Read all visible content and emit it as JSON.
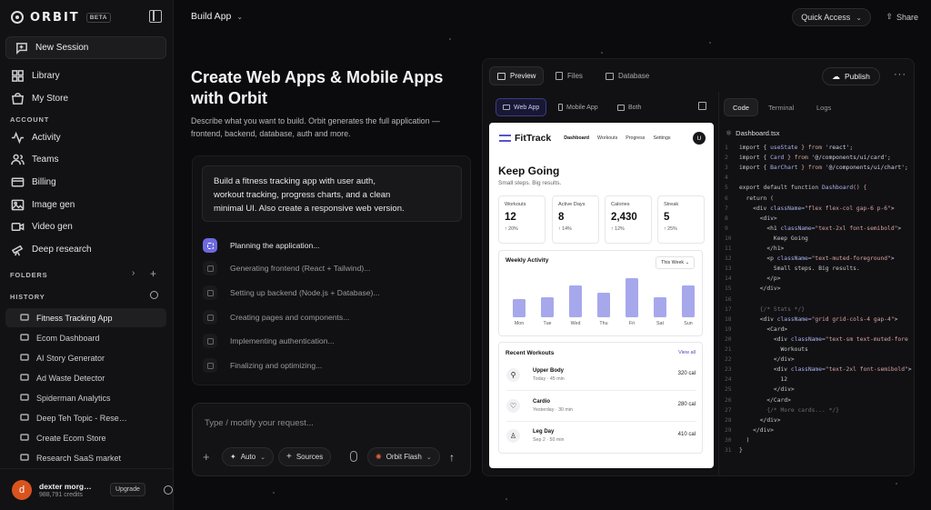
{
  "sidebar": {
    "logo": "ORBIT",
    "badge": "BETA",
    "new_session": "New Session",
    "nav": [
      {
        "label": "Library",
        "icon": "grid-icon"
      },
      {
        "label": "My Store",
        "icon": "store-icon"
      }
    ],
    "account_label": "ACCOUNT",
    "account_items": [
      {
        "label": "Activity",
        "icon": "activity-icon"
      },
      {
        "label": "Teams",
        "icon": "users-icon"
      },
      {
        "label": "Billing",
        "icon": "credit-card-icon"
      },
      {
        "label": "Image gen",
        "icon": "image-icon"
      },
      {
        "label": "Video gen",
        "icon": "video-icon"
      },
      {
        "label": "Deep research",
        "icon": "telescope-icon"
      }
    ],
    "folders_label": "FOLDERS",
    "history_label": "HISTORY",
    "history": [
      "Fitness Tracking App",
      "Ecom Dashboard",
      "AI Story Generator",
      "Ad Waste Detector",
      "Spiderman Analytics",
      "Deep Teh Topic - Rese…",
      "Create Ecom Store",
      "Research SaaS market"
    ],
    "user": {
      "initial": "d",
      "name": "dexter morg…",
      "credits": "988,791 credits",
      "upgrade": "Upgrade"
    }
  },
  "topbar": {
    "title": "Build App",
    "quick_access": "Quick Access",
    "share": "Share"
  },
  "main": {
    "heading_line1": "Create Web Apps & Mobile Apps",
    "heading_line2": "with Orbit",
    "desc_line1": "Describe what you want to build. Orbit generates the full application —",
    "desc_line2": "frontend, backend, database, auth and more.",
    "prompt_line1": "Build a fitness tracking app with user auth,",
    "prompt_line2": "workout tracking, progress charts, and a clean",
    "prompt_line3": "minimal UI. Also create a responsive web version.",
    "steps": [
      "Planning the application...",
      "Generating frontend (React + Tailwind)...",
      "Setting up backend (Node.js + Database)...",
      "Creating pages and components...",
      "Implementing authentication...",
      "Finalizing and optimizing..."
    ],
    "input_placeholder": "Type / modify your request...",
    "auto": "Auto",
    "sources": "Sources",
    "model": "Orbit Flash"
  },
  "workspace": {
    "tabs": [
      "Preview",
      "Files",
      "Database"
    ],
    "publish": "Publish",
    "view_tabs": [
      "Web App",
      "Mobile App",
      "Both"
    ],
    "code_tabs": [
      "Code",
      "Terminal",
      "Logs"
    ],
    "code_file": "Dashboard.tsx"
  },
  "preview": {
    "brand": "FitTrack",
    "nav": [
      "Dashboard",
      "Workouts",
      "Progress",
      "Settings"
    ],
    "avatar": "U",
    "title": "Keep Going",
    "subtitle": "Small steps. Big results.",
    "stats": [
      {
        "label": "Workouts",
        "value": "12",
        "delta": "↑ 20%"
      },
      {
        "label": "Active Days",
        "value": "8",
        "delta": "↑ 14%"
      },
      {
        "label": "Calories",
        "value": "2,430",
        "delta": "↑ 12%"
      },
      {
        "label": "Streak",
        "value": "5",
        "delta": "↑ 25%"
      }
    ],
    "weekly_title": "Weekly Activity",
    "weekly_range": "This Week",
    "recent_title": "Recent Workouts",
    "view_all": "View all",
    "workouts": [
      {
        "name": "Upper Body",
        "meta": "Today · 45 min",
        "cal": "320 cal",
        "icon": "dumbbell-icon"
      },
      {
        "name": "Cardio",
        "meta": "Yesterday · 30 min",
        "cal": "280 cal",
        "icon": "heart-icon"
      },
      {
        "name": "Leg Day",
        "meta": "Sep 2 · 50 min",
        "cal": "410 cal",
        "icon": "leg-icon"
      }
    ]
  },
  "chart_data": {
    "type": "bar",
    "title": "Weekly Activity",
    "categories": [
      "Mon",
      "Tue",
      "Wed",
      "Thu",
      "Fri",
      "Sat",
      "Sun"
    ],
    "values": [
      0.45,
      0.5,
      0.8,
      0.62,
      0.98,
      0.5,
      0.8
    ],
    "ylabel": "",
    "xlabel": ""
  },
  "code": {
    "lines": [
      [
        "import { ",
        "useState",
        " } from ",
        "'react';"
      ],
      [
        "import { ",
        "Card",
        " } from ",
        "'@/components/ui/card';"
      ],
      [
        "import { ",
        "BarChart",
        " } from ",
        "'@/components/ui/chart';"
      ],
      [
        "",
        "",
        "",
        ""
      ],
      [
        "export default function ",
        "Dashboard",
        "() {",
        ""
      ],
      [
        "  return (",
        "",
        "",
        ""
      ],
      [
        "    <div ",
        "className=",
        "\"flex flex-col gap-6 p-6\"",
        ">"
      ],
      [
        "      <div>",
        "",
        "",
        ""
      ],
      [
        "        <h1 ",
        "className=",
        "\"text-2xl font-semibold\"",
        ">"
      ],
      [
        "          Keep Going",
        "",
        "",
        ""
      ],
      [
        "        </h1>",
        "",
        "",
        ""
      ],
      [
        "        <p ",
        "className=",
        "\"text-muted-foreground\"",
        ">"
      ],
      [
        "          Small steps. Big results.",
        "",
        "",
        ""
      ],
      [
        "        </p>",
        "",
        "",
        ""
      ],
      [
        "      </div>",
        "",
        "",
        ""
      ],
      [
        "",
        "",
        "",
        ""
      ],
      [
        "      {/* Stats */}",
        "",
        "",
        ""
      ],
      [
        "      <div ",
        "className=",
        "\"grid grid-cols-4 gap-4\"",
        ">"
      ],
      [
        "        <Card>",
        "",
        "",
        ""
      ],
      [
        "          <div ",
        "className=",
        "\"text-sm text-muted-fore",
        ""
      ],
      [
        "            Workouts",
        "",
        "",
        ""
      ],
      [
        "          </div>",
        "",
        "",
        ""
      ],
      [
        "          <div ",
        "className=",
        "\"text-2xl font-semibold\"",
        ">"
      ],
      [
        "            12",
        "",
        "",
        ""
      ],
      [
        "          </div>",
        "",
        "",
        ""
      ],
      [
        "        </Card>",
        "",
        "",
        ""
      ],
      [
        "        {/* More cards... */}",
        "",
        "",
        ""
      ],
      [
        "      </div>",
        "",
        "",
        ""
      ],
      [
        "    </div>",
        "",
        "",
        ""
      ],
      [
        "  )",
        "",
        "",
        ""
      ],
      [
        "}",
        "",
        "",
        ""
      ]
    ]
  }
}
